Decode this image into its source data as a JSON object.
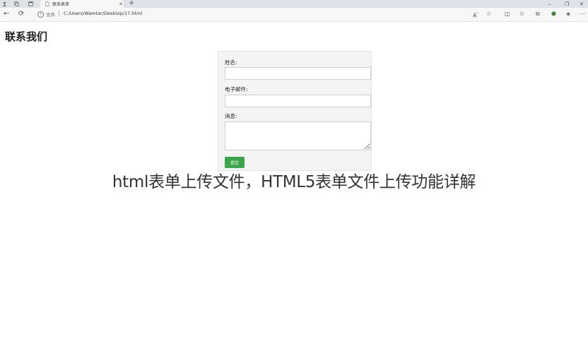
{
  "browser": {
    "tab": {
      "title": "联系表单"
    },
    "address": {
      "file_label": "文件",
      "url": "C:/Users/Wamtar/Desktop/17.html"
    }
  },
  "page": {
    "heading": "联系我们",
    "form": {
      "name_label": "姓名:",
      "email_label": "电子邮件:",
      "message_label": "消息:",
      "submit_label": "提交",
      "name_value": "",
      "email_value": "",
      "message_value": ""
    }
  },
  "overlay": {
    "caption": "html表单上传文件，HTML5表单文件上传功能详解"
  },
  "colors": {
    "submit_button": "#3aa54a",
    "form_background": "#f4f4f4"
  }
}
